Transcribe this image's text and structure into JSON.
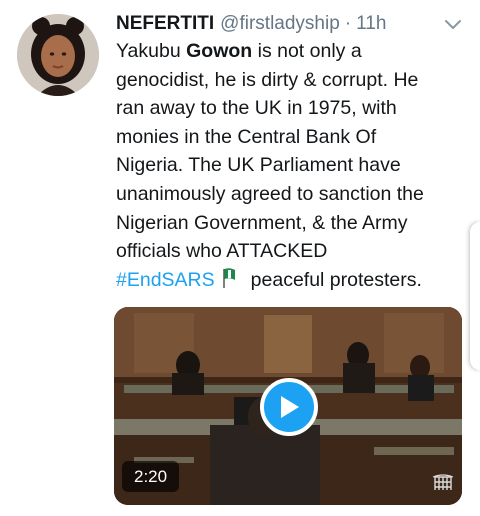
{
  "tweet": {
    "author": {
      "display_name": "NEFERTITI",
      "handle": "@firstladyship",
      "separator": "·",
      "time": "11h"
    },
    "text": {
      "line1_pre": "Yakubu ",
      "line1_bold": "Gowon",
      "line1_post": " is not only a",
      "line2": "genocidist, he is dirty & corrupt. He",
      "line3": "ran away to the UK in 1975, with",
      "line4": "monies in the Central Bank Of",
      "line5": "Nigeria. The UK Parliament have",
      "line6": "unanimously agreed to sanction the",
      "line7": "Nigerian Government, & the Army",
      "line8": "officials who ATTACKED",
      "hashtag": "#EndSARS",
      "line9_post": "peaceful protesters."
    },
    "media": {
      "duration": "2:20",
      "play_icon": "play-icon",
      "watermark_icon": "portcullis-icon"
    }
  },
  "colors": {
    "link": "#1da1f2",
    "secondary_text": "#657786",
    "primary_text": "#14171a"
  }
}
